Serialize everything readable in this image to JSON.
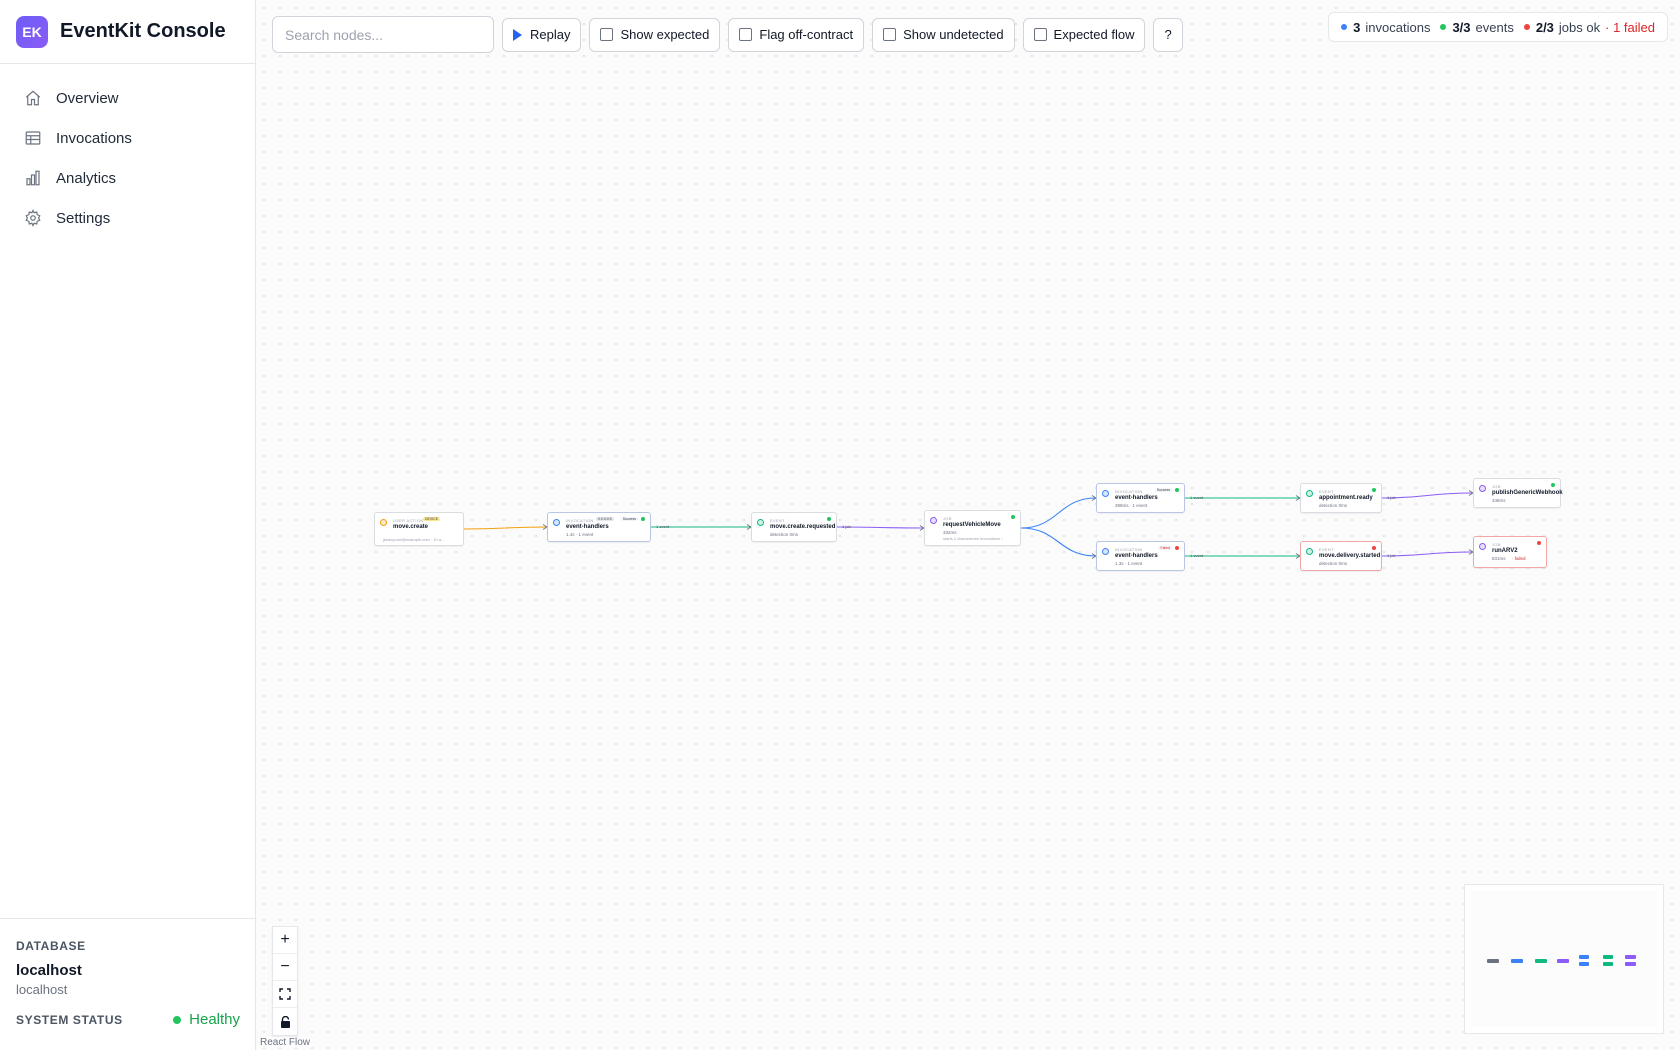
{
  "app": {
    "logo_text": "EK",
    "title": "EventKit Console"
  },
  "sidebar": {
    "items": [
      {
        "label": "Overview",
        "icon": "home-icon"
      },
      {
        "label": "Invocations",
        "icon": "table-icon"
      },
      {
        "label": "Analytics",
        "icon": "bar-chart-icon"
      },
      {
        "label": "Settings",
        "icon": "gear-icon"
      }
    ],
    "footer": {
      "database_heading": "DATABASE",
      "database_host": "localhost",
      "database_sub": "localhost",
      "status_heading": "SYSTEM STATUS",
      "status_value": "Healthy"
    }
  },
  "toolbar": {
    "search_placeholder": "Search nodes...",
    "replay_label": "Replay",
    "show_expected_label": "Show expected",
    "flag_off_contract_label": "Flag off-contract",
    "show_undetected_label": "Show undetected",
    "expected_flow_label": "Expected flow",
    "help_label": "?"
  },
  "stats": {
    "invocations_count": "3",
    "invocations_label": "invocations",
    "events_count": "3/3",
    "events_label": "events",
    "jobs_count": "2/3",
    "jobs_label": "jobs ok",
    "failed_label": "· 1 failed"
  },
  "colors": {
    "user_action": "#f59e0b",
    "invocation": "#3b82f6",
    "event": "#10b981",
    "job": "#8b5cf6",
    "ok": "#22c55e",
    "fail": "#ef4444"
  },
  "flow": {
    "nodes": [
      {
        "id": "n1",
        "type": "USER ACTION",
        "badge": "DEVICE",
        "title": "move.create",
        "sub": "",
        "sub2": "jkwenpush@example.com · 1h a...",
        "icon": "user-icon",
        "color": "user_action",
        "status": ""
      },
      {
        "id": "n2",
        "type": "INVOCATION",
        "badge": "0.0.0.0:3",
        "badge2": "Success",
        "title": "event-handlers",
        "sub": "1.4s · 1 event",
        "sub2": "",
        "icon": "lambda-icon",
        "color": "invocation",
        "status": "ok"
      },
      {
        "id": "n3",
        "type": "EVENT",
        "title": "move.create.requested",
        "sub": "detection 0ms",
        "sub2": "",
        "icon": "event-icon",
        "color": "event",
        "status": "ok"
      },
      {
        "id": "n4",
        "type": "JOB",
        "title": "requestVehicleMove",
        "sub": "332ms",
        "sub2": "starts 2 downstream invocations ›",
        "icon": "job-icon",
        "color": "job",
        "status": "ok"
      },
      {
        "id": "n5",
        "type": "INVOCATION",
        "badge2": "Success",
        "title": "event-handlers",
        "sub": "388ms · 1 event",
        "sub2": "",
        "icon": "lambda-icon",
        "color": "invocation",
        "status": "ok"
      },
      {
        "id": "n6",
        "type": "INVOCATION",
        "badge2": "Failed",
        "title": "event-handlers",
        "sub": "1.3s · 1 event",
        "sub2": "",
        "icon": "lambda-icon",
        "color": "invocation",
        "status": "fail"
      },
      {
        "id": "n7",
        "type": "EVENT",
        "title": "appointment.ready",
        "sub": "detection 0ms",
        "sub2": "",
        "icon": "event-icon",
        "color": "event",
        "status": "ok"
      },
      {
        "id": "n8",
        "type": "EVENT",
        "title": "move.delivery.started",
        "sub": "detection 0ms",
        "sub2": "",
        "icon": "event-icon",
        "color": "event",
        "status": "fail"
      },
      {
        "id": "n9",
        "type": "JOB",
        "title": "publishGenericWebhook",
        "sub": "348ms",
        "sub2": "",
        "icon": "job-icon",
        "color": "job",
        "status": "ok"
      },
      {
        "id": "n10",
        "type": "JOB",
        "title": "runARV2",
        "sub": "831ms",
        "sub_fail": "· failed",
        "sub2": "",
        "icon": "job-icon",
        "color": "job",
        "status": "fail"
      }
    ],
    "edges": [
      {
        "from": "n1",
        "to": "n2",
        "label": "",
        "color": "user_action"
      },
      {
        "from": "n2",
        "to": "n3",
        "label": "1 event",
        "color": "event"
      },
      {
        "from": "n3",
        "to": "n4",
        "label": "1 job",
        "color": "job"
      },
      {
        "from": "n4",
        "to": "n5",
        "label": "",
        "color": "invocation"
      },
      {
        "from": "n4",
        "to": "n6",
        "label": "",
        "color": "invocation"
      },
      {
        "from": "n5",
        "to": "n7",
        "label": "1 event",
        "color": "event"
      },
      {
        "from": "n6",
        "to": "n8",
        "label": "1 event",
        "color": "event"
      },
      {
        "from": "n7",
        "to": "n9",
        "label": "1 job",
        "color": "job"
      },
      {
        "from": "n8",
        "to": "n10",
        "label": "1 job",
        "color": "job"
      }
    ]
  },
  "controls": {
    "zoom_in": "+",
    "zoom_out": "−",
    "fit_icon": "fit-view-icon",
    "lock_icon": "lock-icon",
    "attribution": "React Flow"
  }
}
